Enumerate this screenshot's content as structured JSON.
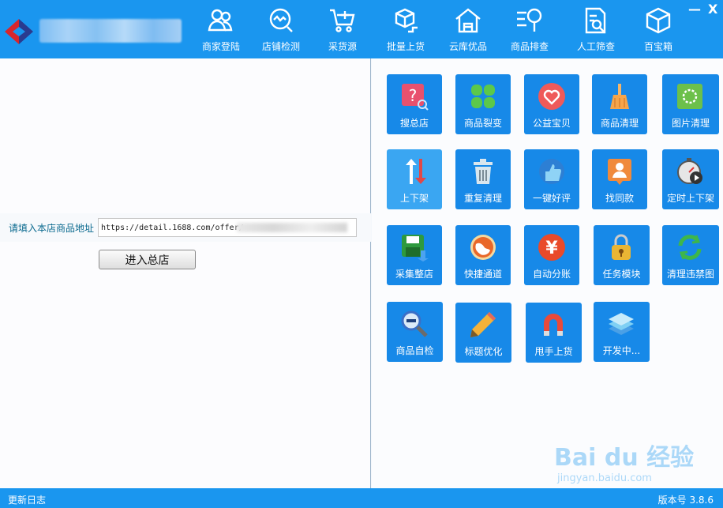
{
  "header": {
    "title": "",
    "nav": [
      {
        "label": "商家登陆",
        "icon": "users-icon"
      },
      {
        "label": "店铺检测",
        "icon": "monitor-check-icon"
      },
      {
        "label": "采货源",
        "icon": "cart-plus-icon"
      },
      {
        "label": "批量上货",
        "icon": "box-upload-icon"
      },
      {
        "label": "云库优品",
        "icon": "warehouse-icon"
      },
      {
        "label": "商品排查",
        "icon": "search-list-icon"
      },
      {
        "label": "人工筛查",
        "icon": "document-search-icon"
      },
      {
        "label": "百宝箱",
        "icon": "cube-icon"
      }
    ],
    "minimize_label": "—",
    "close_label": "X"
  },
  "left": {
    "url_label": "请填入本店商品地址",
    "url_value": "https://detail.1688.com/offer/",
    "enter_button": "进入总店"
  },
  "tiles": [
    {
      "label": "搜总店",
      "icon": "question-search-icon",
      "color": "#e8516e"
    },
    {
      "label": "商品裂变",
      "icon": "clover-icon",
      "color": "#5cc84a"
    },
    {
      "label": "公益宝贝",
      "icon": "heart-icon",
      "color": "#ef5a5a"
    },
    {
      "label": "商品清理",
      "icon": "broom-icon",
      "color": "#f5a54a"
    },
    {
      "label": "图片清理",
      "icon": "image-clean-icon",
      "color": "#6cc04a"
    },
    {
      "label": "上下架",
      "icon": "up-down-arrows-icon",
      "color": "#e04848"
    },
    {
      "label": "重复清理",
      "icon": "trash-icon",
      "color": "#d9e6ee"
    },
    {
      "label": "一键好评",
      "icon": "thumbs-up-icon",
      "color": "#8fd3f6"
    },
    {
      "label": "找同款",
      "icon": "user-card-icon",
      "color": "#f08a3c"
    },
    {
      "label": "定时上下架",
      "icon": "stopwatch-play-icon",
      "color": "#e6e6e6"
    },
    {
      "label": "采集整店",
      "icon": "save-disk-icon",
      "color": "#2e9a3e"
    },
    {
      "label": "快捷通道",
      "icon": "globe-icon",
      "color": "#e9682a"
    },
    {
      "label": "自动分账",
      "icon": "yuan-coin-icon",
      "color": "#e94a2a"
    },
    {
      "label": "任务模块",
      "icon": "padlock-icon",
      "color": "#e9b534"
    },
    {
      "label": "清理违禁图",
      "icon": "refresh-cycle-icon",
      "color": "#3eb64a"
    },
    {
      "label": "商品自检",
      "icon": "magnifier-minus-icon",
      "color": "#3a6fc7"
    },
    {
      "label": "标题优化",
      "icon": "pencil-icon",
      "color": "#f4b23a"
    },
    {
      "label": "甩手上货",
      "icon": "magnet-icon",
      "color": "#e94a3a"
    },
    {
      "label": "开发中...",
      "icon": "layers-icon",
      "color": "#7fd0f4"
    }
  ],
  "status": {
    "log_label": "更新日志",
    "version_label": "版本号 3.8.6"
  },
  "watermark": {
    "brand": "Bai du 经验",
    "url": "jingyan.baidu.com"
  }
}
